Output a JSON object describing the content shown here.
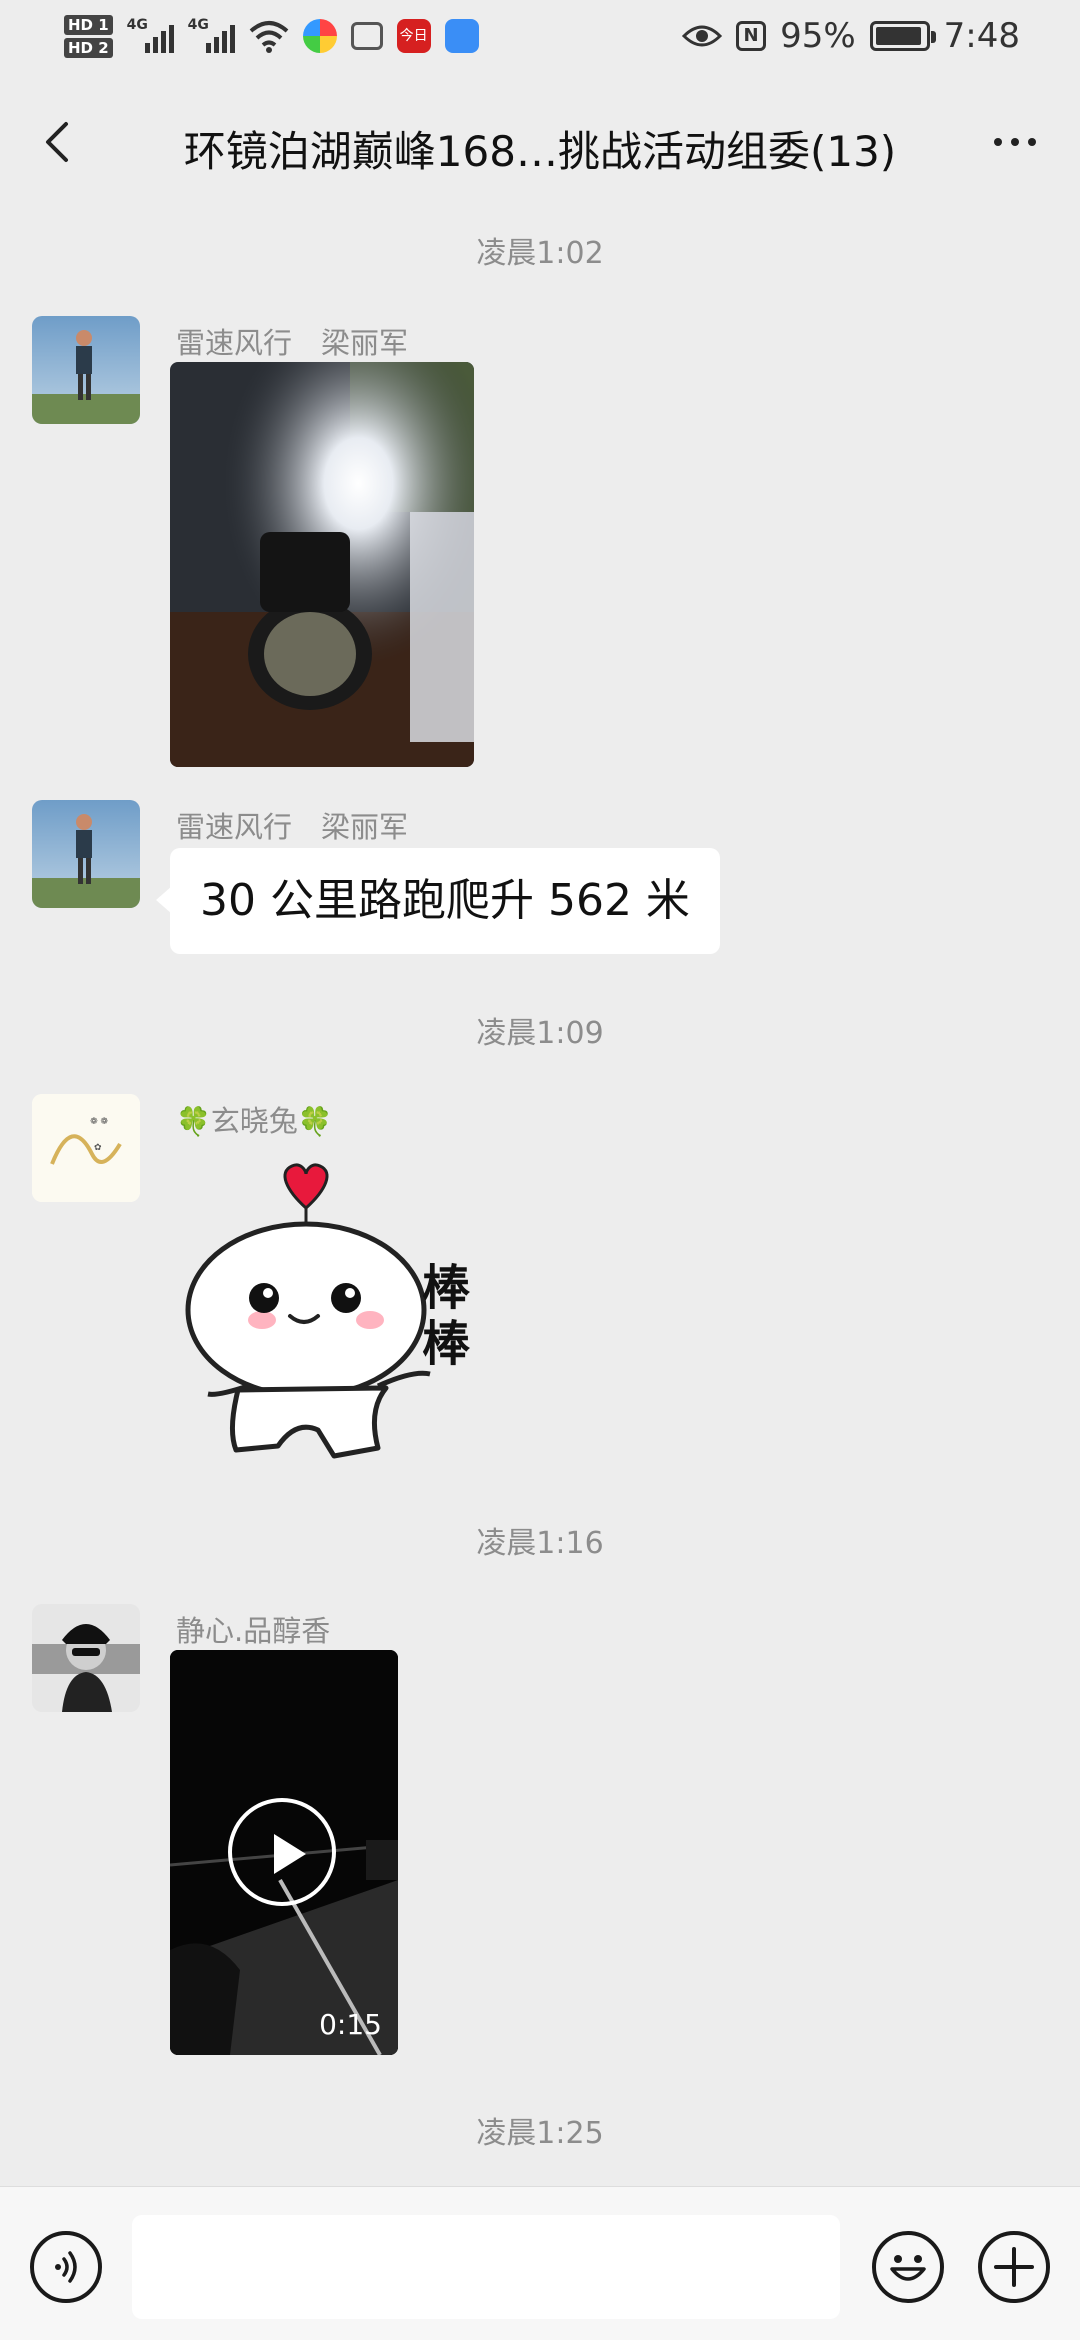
{
  "status_bar": {
    "hd1": "HD 1",
    "hd2": "HD 2",
    "net1": "4G",
    "net2": "4G",
    "app_red_text": "今日",
    "battery_percent": "95%",
    "battery_level": 0.95,
    "time": "7:48",
    "nfc": "N"
  },
  "header": {
    "title": "环镜泊湖巅峰168…挑战活动组委(13)"
  },
  "messages": {
    "ts1": "凌晨1:02",
    "m1_sender": "雷速风行　梁丽军",
    "m2_sender": "雷速风行　梁丽军",
    "m2_text": "30 公里路跑爬升 562 米",
    "ts2": "凌晨1:09",
    "m3_sender": "玄晓兔",
    "m3_sticker_text": "棒棒",
    "ts3": "凌晨1:16",
    "m4_sender": "静心.品醇香",
    "m4_video_duration": "0:15",
    "ts4": "凌晨1:25"
  },
  "colors": {
    "background": "#ededed",
    "bubble": "#ffffff",
    "timestamp": "#8c8c8c",
    "sticker_heart": "#e8193c"
  }
}
